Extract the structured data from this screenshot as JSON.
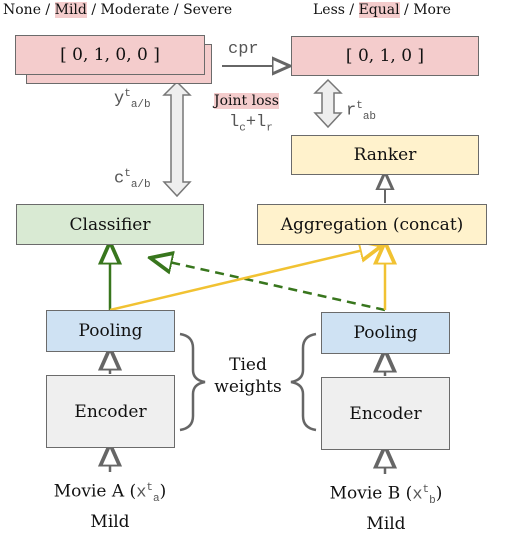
{
  "severity_header": {
    "prefix": "None / ",
    "highlight": "Mild",
    "suffix": " / Moderate / Severe"
  },
  "rank_header": {
    "prefix": "Less / ",
    "highlight": "Equal",
    "suffix": " / More"
  },
  "severity_vector": "[ 0, 1, 0, 0 ]",
  "rank_vector": "[ 0, 1, 0 ]",
  "cpr_label": "cpr",
  "y_symbol": {
    "base": "y",
    "sup": "t",
    "sub": "a/b"
  },
  "c_symbol": {
    "base": "c",
    "sup": "t",
    "sub": "a/b"
  },
  "r_symbol": {
    "base": "r",
    "sup": "t",
    "sub": "ab"
  },
  "joint_loss": {
    "label": "Joint loss",
    "formula_l1": "l",
    "formula_sub1": "c",
    "formula_plus": "+",
    "formula_l2": "l",
    "formula_sub2": "r"
  },
  "boxes": {
    "ranker": "Ranker",
    "classifier": "Classifier",
    "aggregation": "Aggregation (concat)",
    "pooling_a": "Pooling",
    "pooling_b": "Pooling",
    "encoder_a": "Encoder",
    "encoder_b": "Encoder"
  },
  "tied_weights": {
    "line1": "Tied",
    "line2": "weights"
  },
  "movie_a": {
    "name": "Movie A (",
    "sym_base": "x",
    "sym_sup": "t",
    "sym_sub": "a",
    "close": ")",
    "label": "Mild"
  },
  "movie_b": {
    "name": "Movie B (",
    "sym_base": "x",
    "sym_sup": "t",
    "sym_sub": "b",
    "close": ")",
    "label": "Mild"
  },
  "colors": {
    "pink": "#f4cccc",
    "green": "#d9ead3",
    "yellow": "#fff2cc",
    "blue": "#cfe2f3",
    "gray": "#efefef",
    "green_arrow": "#38761d",
    "yellow_arrow": "#f1c232",
    "gray_arrow": "#666666"
  }
}
